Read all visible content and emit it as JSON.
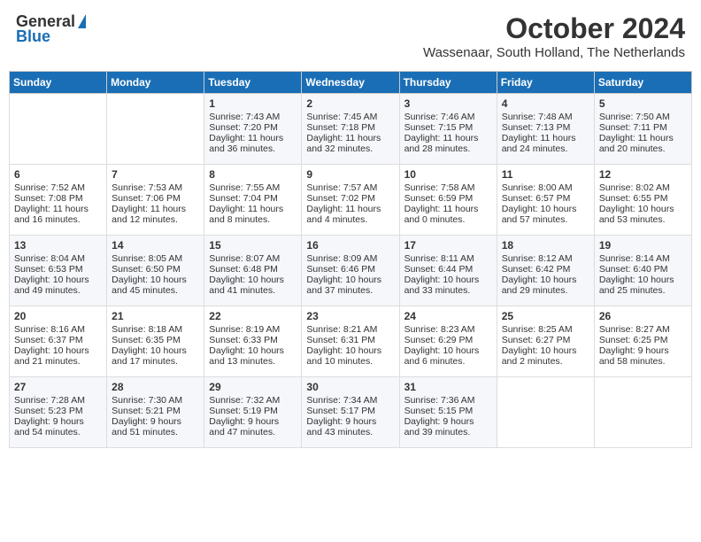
{
  "header": {
    "logo_general": "General",
    "logo_blue": "Blue",
    "title": "October 2024",
    "subtitle": "Wassenaar, South Holland, The Netherlands"
  },
  "days_of_week": [
    "Sunday",
    "Monday",
    "Tuesday",
    "Wednesday",
    "Thursday",
    "Friday",
    "Saturday"
  ],
  "weeks": [
    [
      {
        "num": "",
        "sunrise": "",
        "sunset": "",
        "daylight": ""
      },
      {
        "num": "",
        "sunrise": "",
        "sunset": "",
        "daylight": ""
      },
      {
        "num": "1",
        "sunrise": "Sunrise: 7:43 AM",
        "sunset": "Sunset: 7:20 PM",
        "daylight": "Daylight: 11 hours and 36 minutes."
      },
      {
        "num": "2",
        "sunrise": "Sunrise: 7:45 AM",
        "sunset": "Sunset: 7:18 PM",
        "daylight": "Daylight: 11 hours and 32 minutes."
      },
      {
        "num": "3",
        "sunrise": "Sunrise: 7:46 AM",
        "sunset": "Sunset: 7:15 PM",
        "daylight": "Daylight: 11 hours and 28 minutes."
      },
      {
        "num": "4",
        "sunrise": "Sunrise: 7:48 AM",
        "sunset": "Sunset: 7:13 PM",
        "daylight": "Daylight: 11 hours and 24 minutes."
      },
      {
        "num": "5",
        "sunrise": "Sunrise: 7:50 AM",
        "sunset": "Sunset: 7:11 PM",
        "daylight": "Daylight: 11 hours and 20 minutes."
      }
    ],
    [
      {
        "num": "6",
        "sunrise": "Sunrise: 7:52 AM",
        "sunset": "Sunset: 7:08 PM",
        "daylight": "Daylight: 11 hours and 16 minutes."
      },
      {
        "num": "7",
        "sunrise": "Sunrise: 7:53 AM",
        "sunset": "Sunset: 7:06 PM",
        "daylight": "Daylight: 11 hours and 12 minutes."
      },
      {
        "num": "8",
        "sunrise": "Sunrise: 7:55 AM",
        "sunset": "Sunset: 7:04 PM",
        "daylight": "Daylight: 11 hours and 8 minutes."
      },
      {
        "num": "9",
        "sunrise": "Sunrise: 7:57 AM",
        "sunset": "Sunset: 7:02 PM",
        "daylight": "Daylight: 11 hours and 4 minutes."
      },
      {
        "num": "10",
        "sunrise": "Sunrise: 7:58 AM",
        "sunset": "Sunset: 6:59 PM",
        "daylight": "Daylight: 11 hours and 0 minutes."
      },
      {
        "num": "11",
        "sunrise": "Sunrise: 8:00 AM",
        "sunset": "Sunset: 6:57 PM",
        "daylight": "Daylight: 10 hours and 57 minutes."
      },
      {
        "num": "12",
        "sunrise": "Sunrise: 8:02 AM",
        "sunset": "Sunset: 6:55 PM",
        "daylight": "Daylight: 10 hours and 53 minutes."
      }
    ],
    [
      {
        "num": "13",
        "sunrise": "Sunrise: 8:04 AM",
        "sunset": "Sunset: 6:53 PM",
        "daylight": "Daylight: 10 hours and 49 minutes."
      },
      {
        "num": "14",
        "sunrise": "Sunrise: 8:05 AM",
        "sunset": "Sunset: 6:50 PM",
        "daylight": "Daylight: 10 hours and 45 minutes."
      },
      {
        "num": "15",
        "sunrise": "Sunrise: 8:07 AM",
        "sunset": "Sunset: 6:48 PM",
        "daylight": "Daylight: 10 hours and 41 minutes."
      },
      {
        "num": "16",
        "sunrise": "Sunrise: 8:09 AM",
        "sunset": "Sunset: 6:46 PM",
        "daylight": "Daylight: 10 hours and 37 minutes."
      },
      {
        "num": "17",
        "sunrise": "Sunrise: 8:11 AM",
        "sunset": "Sunset: 6:44 PM",
        "daylight": "Daylight: 10 hours and 33 minutes."
      },
      {
        "num": "18",
        "sunrise": "Sunrise: 8:12 AM",
        "sunset": "Sunset: 6:42 PM",
        "daylight": "Daylight: 10 hours and 29 minutes."
      },
      {
        "num": "19",
        "sunrise": "Sunrise: 8:14 AM",
        "sunset": "Sunset: 6:40 PM",
        "daylight": "Daylight: 10 hours and 25 minutes."
      }
    ],
    [
      {
        "num": "20",
        "sunrise": "Sunrise: 8:16 AM",
        "sunset": "Sunset: 6:37 PM",
        "daylight": "Daylight: 10 hours and 21 minutes."
      },
      {
        "num": "21",
        "sunrise": "Sunrise: 8:18 AM",
        "sunset": "Sunset: 6:35 PM",
        "daylight": "Daylight: 10 hours and 17 minutes."
      },
      {
        "num": "22",
        "sunrise": "Sunrise: 8:19 AM",
        "sunset": "Sunset: 6:33 PM",
        "daylight": "Daylight: 10 hours and 13 minutes."
      },
      {
        "num": "23",
        "sunrise": "Sunrise: 8:21 AM",
        "sunset": "Sunset: 6:31 PM",
        "daylight": "Daylight: 10 hours and 10 minutes."
      },
      {
        "num": "24",
        "sunrise": "Sunrise: 8:23 AM",
        "sunset": "Sunset: 6:29 PM",
        "daylight": "Daylight: 10 hours and 6 minutes."
      },
      {
        "num": "25",
        "sunrise": "Sunrise: 8:25 AM",
        "sunset": "Sunset: 6:27 PM",
        "daylight": "Daylight: 10 hours and 2 minutes."
      },
      {
        "num": "26",
        "sunrise": "Sunrise: 8:27 AM",
        "sunset": "Sunset: 6:25 PM",
        "daylight": "Daylight: 9 hours and 58 minutes."
      }
    ],
    [
      {
        "num": "27",
        "sunrise": "Sunrise: 7:28 AM",
        "sunset": "Sunset: 5:23 PM",
        "daylight": "Daylight: 9 hours and 54 minutes."
      },
      {
        "num": "28",
        "sunrise": "Sunrise: 7:30 AM",
        "sunset": "Sunset: 5:21 PM",
        "daylight": "Daylight: 9 hours and 51 minutes."
      },
      {
        "num": "29",
        "sunrise": "Sunrise: 7:32 AM",
        "sunset": "Sunset: 5:19 PM",
        "daylight": "Daylight: 9 hours and 47 minutes."
      },
      {
        "num": "30",
        "sunrise": "Sunrise: 7:34 AM",
        "sunset": "Sunset: 5:17 PM",
        "daylight": "Daylight: 9 hours and 43 minutes."
      },
      {
        "num": "31",
        "sunrise": "Sunrise: 7:36 AM",
        "sunset": "Sunset: 5:15 PM",
        "daylight": "Daylight: 9 hours and 39 minutes."
      },
      {
        "num": "",
        "sunrise": "",
        "sunset": "",
        "daylight": ""
      },
      {
        "num": "",
        "sunrise": "",
        "sunset": "",
        "daylight": ""
      }
    ]
  ]
}
